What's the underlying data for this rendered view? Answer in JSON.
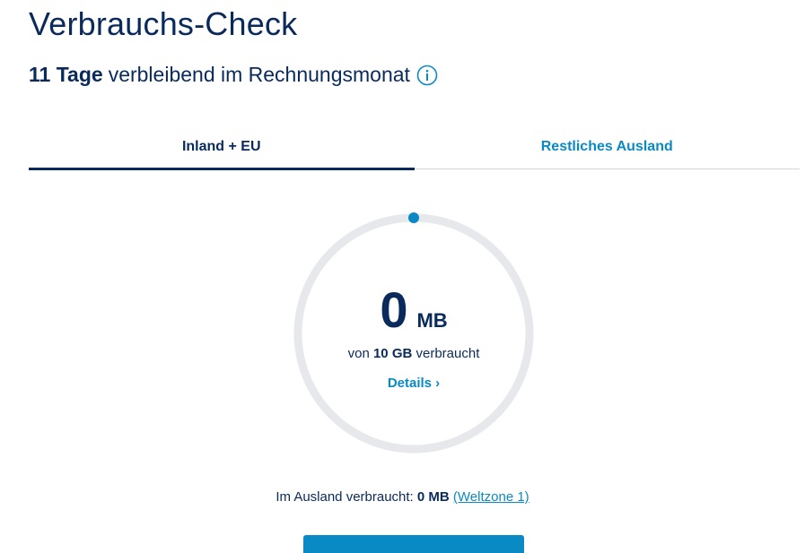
{
  "page": {
    "title": "Verbrauchs-Check",
    "remaining_days": "11 Tage",
    "remaining_text": "verbleibend im Rechnungsmonat"
  },
  "tabs": [
    {
      "label": "Inland + EU",
      "active": true
    },
    {
      "label": "Restliches Ausland",
      "active": false
    }
  ],
  "usage": {
    "used_value": "0",
    "used_unit": "MB",
    "of_prefix": "von",
    "quota": "10 GB",
    "of_suffix": "verbraucht",
    "details_label": "Details ›",
    "used_fraction": 0
  },
  "abroad": {
    "prefix": "Im Ausland verbraucht:",
    "value": "0 MB",
    "zone_link": "(Weltzone 1)"
  },
  "colors": {
    "primary": "#0a2a5c",
    "accent": "#0a8ac5",
    "track": "#e6e8eb"
  },
  "icons": {
    "info": "info-circle-icon"
  }
}
